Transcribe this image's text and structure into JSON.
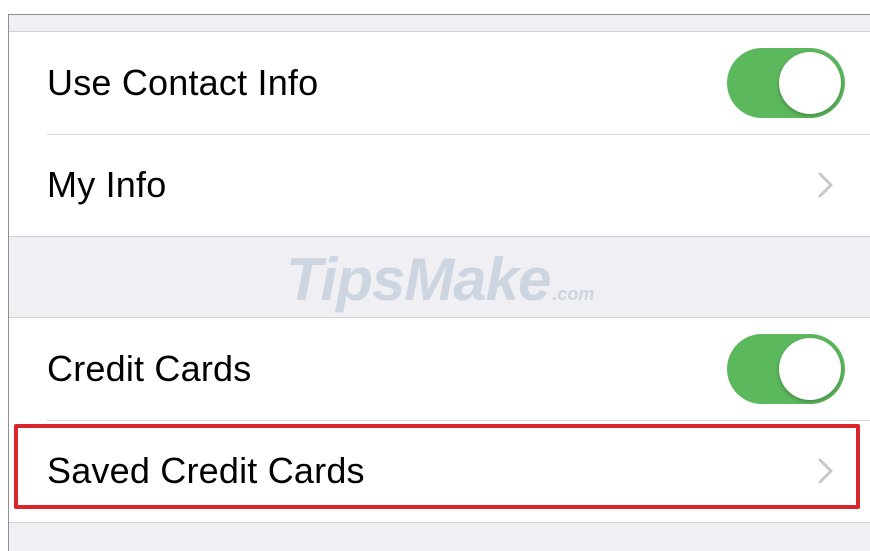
{
  "settings": {
    "group1": {
      "use_contact_info": {
        "label": "Use Contact Info",
        "toggle_on": true
      },
      "my_info": {
        "label": "My Info"
      }
    },
    "watermark": {
      "brand": "TipsMake",
      "suffix": ".com"
    },
    "group2": {
      "credit_cards": {
        "label": "Credit Cards",
        "toggle_on": true
      },
      "saved_credit_cards": {
        "label": "Saved Credit Cards"
      }
    }
  },
  "colors": {
    "toggle_on": "#5cb85c",
    "highlight": "#d9262a",
    "background": "#efeff4"
  },
  "icons": {
    "chevron": "chevron-right-icon"
  }
}
